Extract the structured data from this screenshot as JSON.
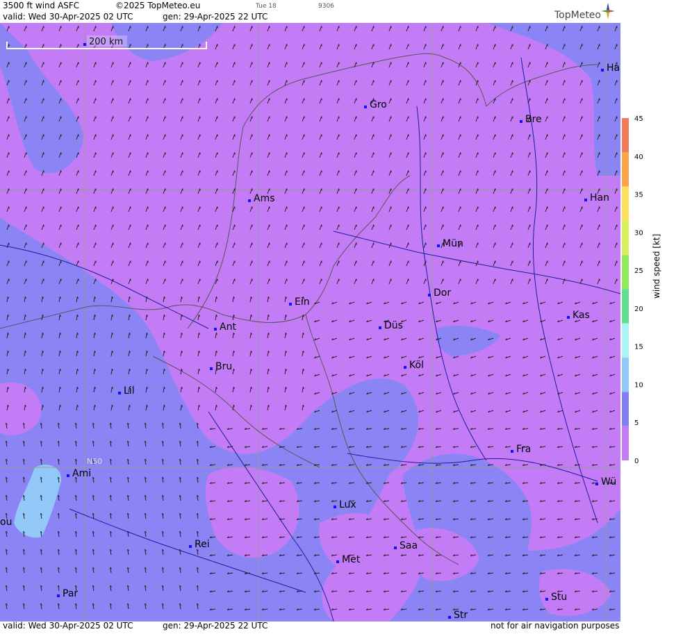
{
  "header": {
    "product": "3500 ft wind ASFC",
    "copyright": "©2025 TopMeteo.eu",
    "tab_small": "Tue 18",
    "code_small": "9306",
    "valid": "valid:  Wed  30-Apr-2025  02 UTC",
    "gen": "gen: 29-Apr-2025 22 UTC",
    "logo": "TopMeteo"
  },
  "scale_bar": "200 km",
  "lat_label": "N50",
  "cities": [
    {
      "id": "ha",
      "label": "Ha"
    },
    {
      "id": "gro",
      "label": "Gro"
    },
    {
      "id": "bre",
      "label": "Bre"
    },
    {
      "id": "ams",
      "label": "Ams"
    },
    {
      "id": "han",
      "label": "Han"
    },
    {
      "id": "mun",
      "label": "Mün"
    },
    {
      "id": "dor",
      "label": "Dor"
    },
    {
      "id": "ein",
      "label": "Ein"
    },
    {
      "id": "kas",
      "label": "Kas"
    },
    {
      "id": "ant",
      "label": "Ant"
    },
    {
      "id": "dus",
      "label": "Düs"
    },
    {
      "id": "kol",
      "label": "Köl"
    },
    {
      "id": "bru",
      "label": "Bru"
    },
    {
      "id": "lil",
      "label": "Lil"
    },
    {
      "id": "fra",
      "label": "Fra"
    },
    {
      "id": "ami",
      "label": "Ami"
    },
    {
      "id": "wu",
      "label": "Wü"
    },
    {
      "id": "lux",
      "label": "Lux"
    },
    {
      "id": "ou",
      "label": "ou"
    },
    {
      "id": "rei",
      "label": "Rei"
    },
    {
      "id": "saa",
      "label": "Saa"
    },
    {
      "id": "met",
      "label": "Met"
    },
    {
      "id": "par",
      "label": "Par"
    },
    {
      "id": "stu",
      "label": "Stu"
    },
    {
      "id": "str",
      "label": "Str"
    }
  ],
  "legend": {
    "title": "wind speed [kt]",
    "ticks": [
      "45",
      "40",
      "35",
      "30",
      "25",
      "20",
      "15",
      "10",
      "5",
      "0"
    ],
    "colors": [
      "#f07a5a",
      "#f9a448",
      "#fde05a",
      "#d8f060",
      "#90ea5a",
      "#5ee08e",
      "#aaf4f8",
      "#92c8f8",
      "#8080f4",
      "#c47cf6"
    ]
  },
  "footer": {
    "valid": "valid:  Wed  30-Apr-2025  02 UTC",
    "gen": "gen: 29-Apr-2025 22 UTC",
    "note": "not for air navigation purposes"
  }
}
